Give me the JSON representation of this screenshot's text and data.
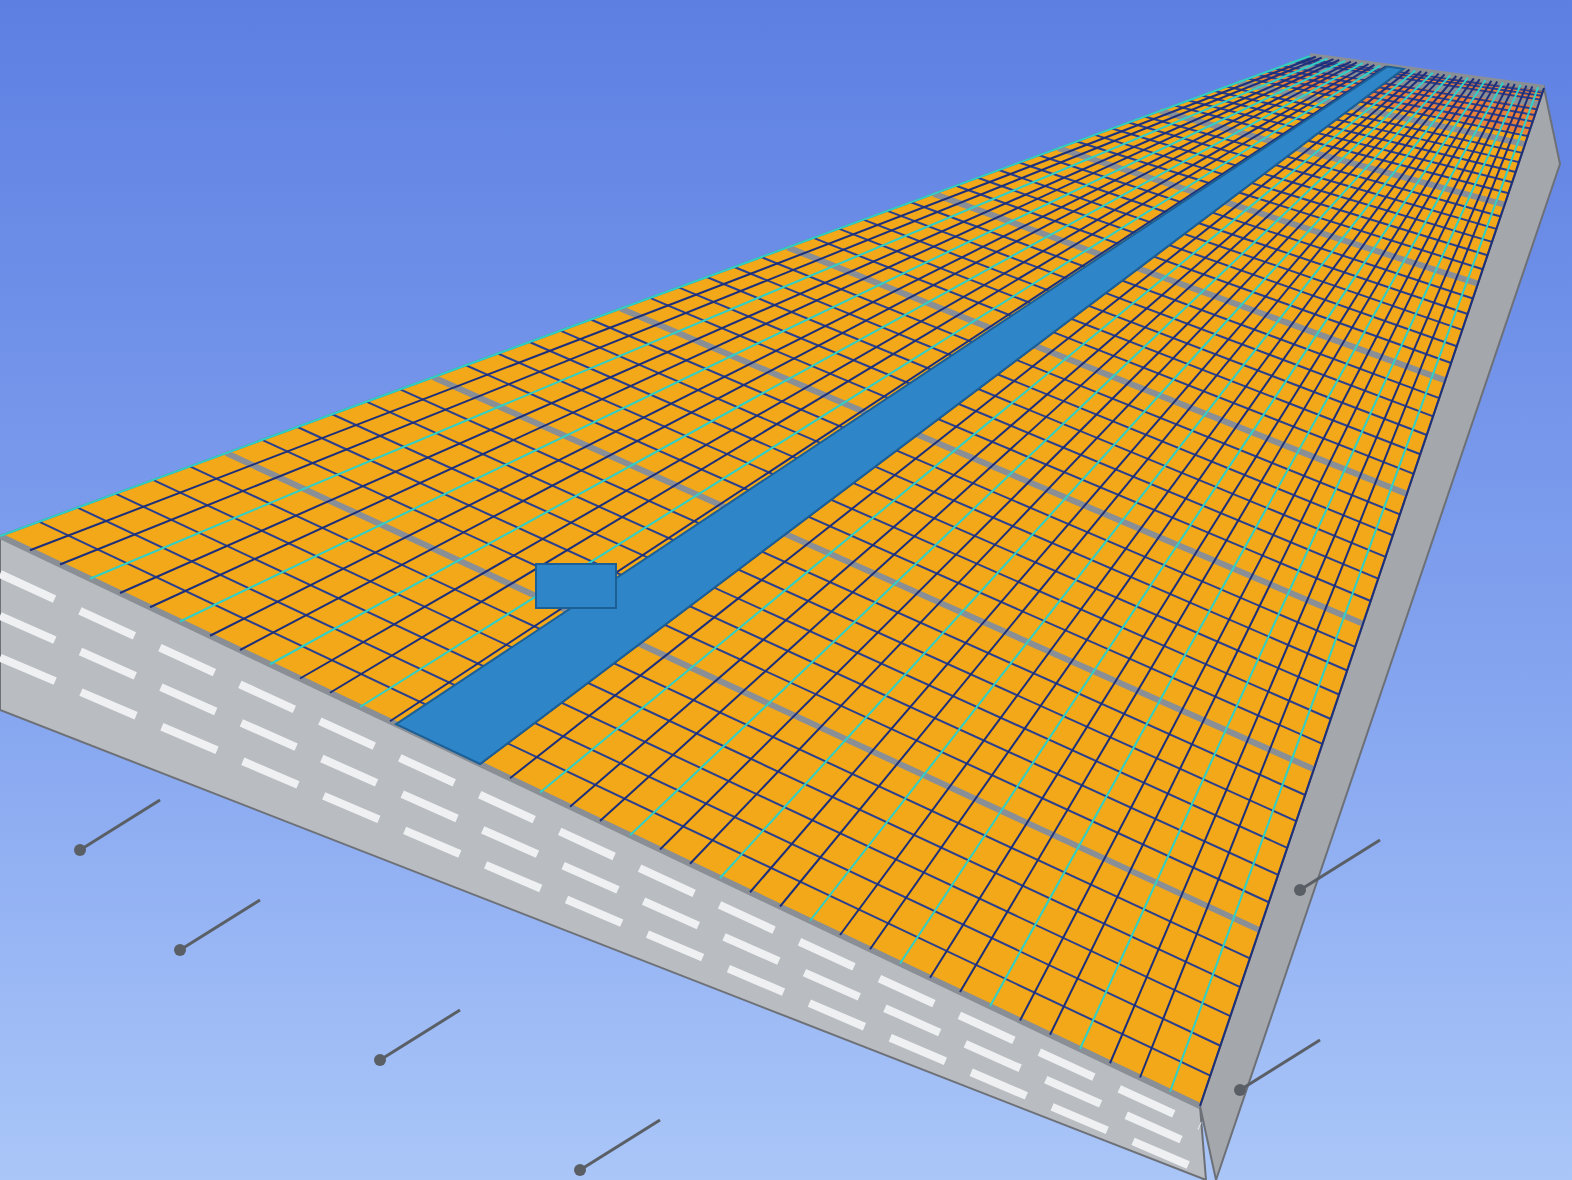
{
  "viewport": {
    "kind": "building"
  }
}
